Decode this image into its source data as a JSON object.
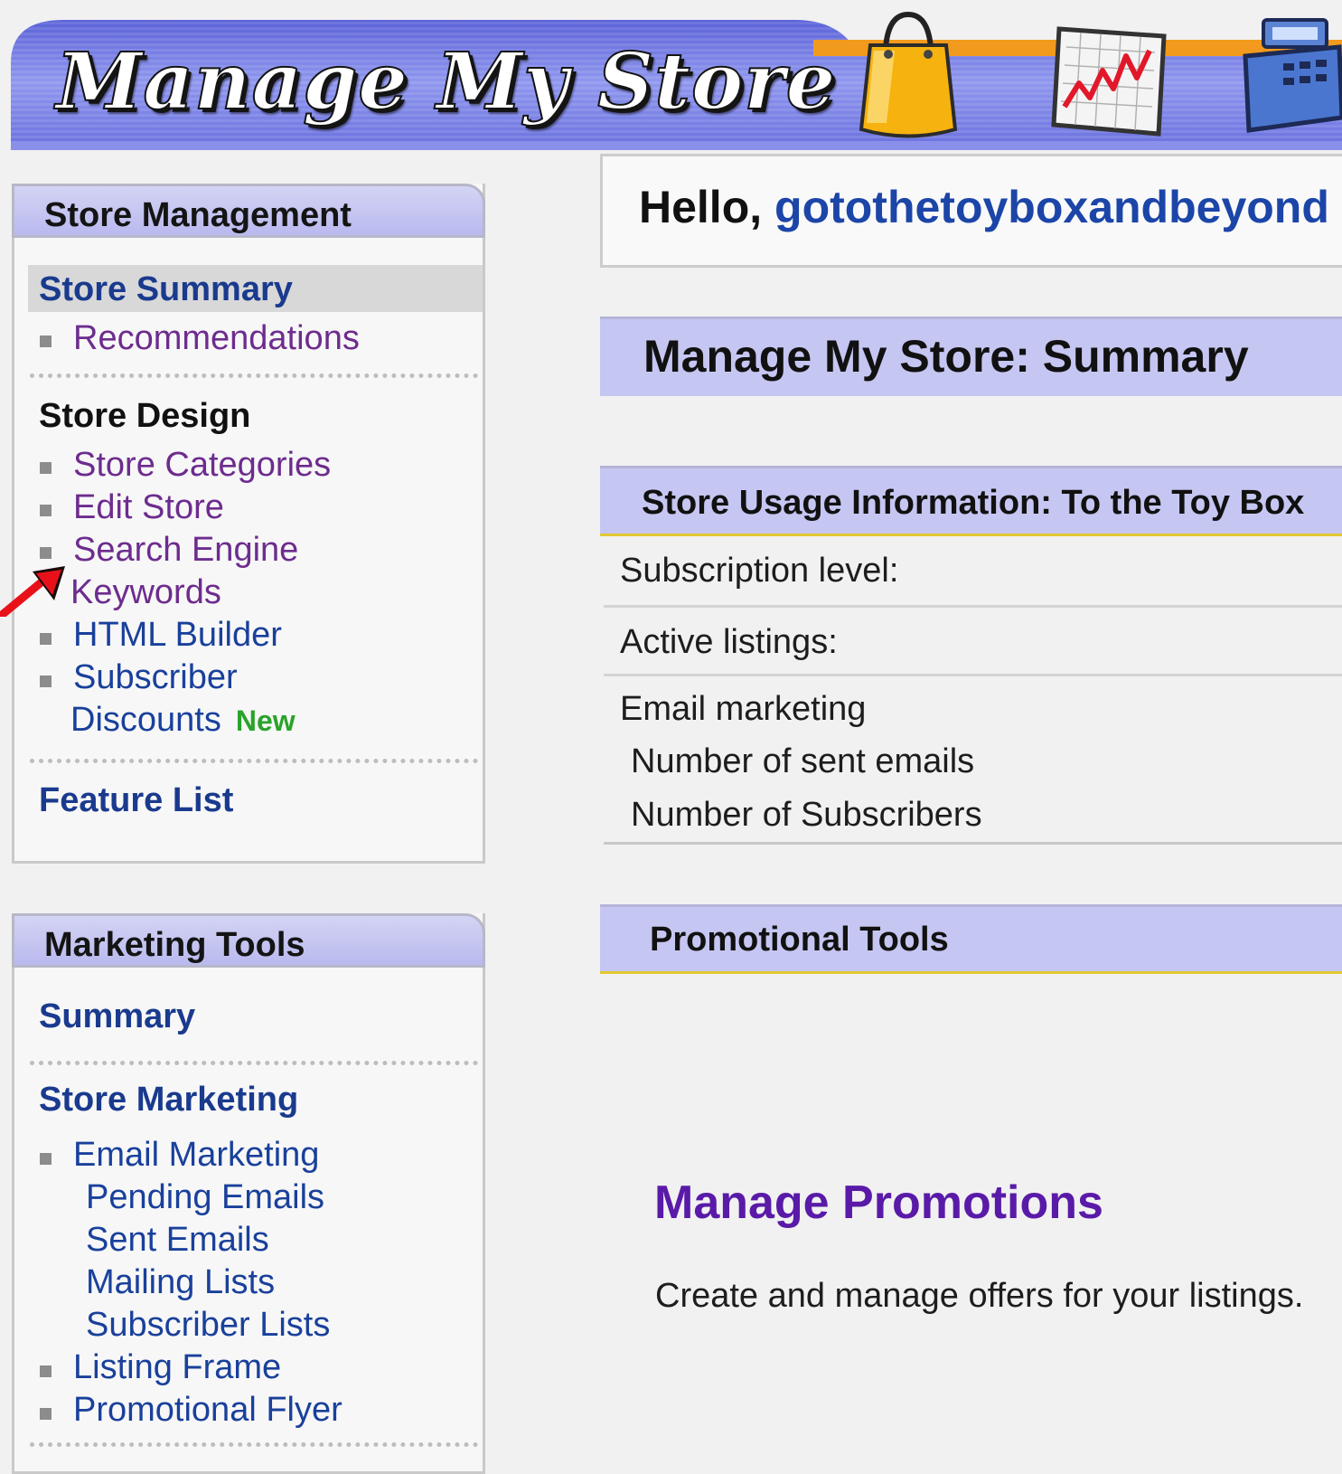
{
  "banner": {
    "title": "Manage My Store",
    "icons": [
      "shopping-bag-icon",
      "chart-icon",
      "cash-register-icon"
    ]
  },
  "store_management": {
    "header": "Store Management",
    "summary_link": "Store Summary",
    "recommendations": "Recommendations",
    "design_heading": "Store Design",
    "store_categories": "Store Categories",
    "edit_store": "Edit Store",
    "search_engine_line1": "Search Engine",
    "search_engine_line2": "Keywords",
    "html_builder": "HTML Builder",
    "subscriber_line1": "Subscriber",
    "subscriber_line2": "Discounts",
    "new_badge": "New",
    "feature_list": "Feature List"
  },
  "marketing_tools": {
    "header": "Marketing Tools",
    "summary": "Summary",
    "store_marketing": "Store Marketing",
    "email_marketing": "Email Marketing",
    "pending_emails": "Pending Emails",
    "sent_emails": "Sent Emails",
    "mailing_lists": "Mailing Lists",
    "subscriber_lists": "Subscriber Lists",
    "listing_frame": "Listing Frame",
    "promotional_flyer": "Promotional Flyer"
  },
  "main": {
    "hello_prefix": "Hello, ",
    "username": "gotothetoyboxandbeyond",
    "page_title": "Manage My Store: Summary",
    "usage_title": "Store Usage Information: To the Toy Box",
    "subscription_level": "Subscription level:",
    "active_listings": "Active listings:",
    "email_marketing": "Email marketing",
    "sent_emails": "Number of sent emails",
    "subscribers": "Number of Subscribers",
    "promo_title": "Promotional Tools",
    "manage_promotions": "Manage Promotions",
    "promo_description": "Create and manage offers for your listings."
  },
  "colors": {
    "banner_blue": "#7f86e6",
    "header_lavender": "#c6c6f2",
    "link_purple": "#6d2c8e",
    "link_blue": "#19409b",
    "new_green": "#29a329",
    "annotation_arrow": "#e8111a"
  }
}
